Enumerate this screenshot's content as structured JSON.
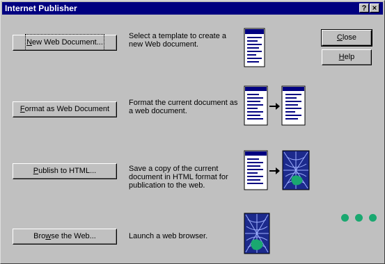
{
  "window": {
    "title": "Internet Publisher"
  },
  "titlebar": {
    "help_glyph": "?",
    "close_glyph": "×"
  },
  "actions": [
    {
      "label_pre": "",
      "label_mnemonic": "N",
      "label_post": "ew Web Document...",
      "description": "Select a template to create a new Web document.",
      "icon": "document-icon"
    },
    {
      "label_pre": "",
      "label_mnemonic": "F",
      "label_post": "ormat as Web Document",
      "description": "Format the current document as a web document.",
      "icon": "document-to-webdoc-icon"
    },
    {
      "label_pre": "",
      "label_mnemonic": "P",
      "label_post": "ublish to HTML...",
      "description": "Save a copy of the current document in HTML format for publication to the web.",
      "icon": "document-to-web-icon"
    },
    {
      "label_pre": "Bro",
      "label_mnemonic": "w",
      "label_post": "se the Web...",
      "description": "Launch a web browser.",
      "icon": "web-spider-icon"
    }
  ],
  "side_buttons": {
    "close": {
      "pre": "",
      "mnemonic": "C",
      "post": "lose"
    },
    "help": {
      "pre": "",
      "mnemonic": "H",
      "post": "elp"
    }
  },
  "colors": {
    "title_bg": "#000080",
    "face": "#c0c0c0",
    "dots": "#1aa870"
  }
}
